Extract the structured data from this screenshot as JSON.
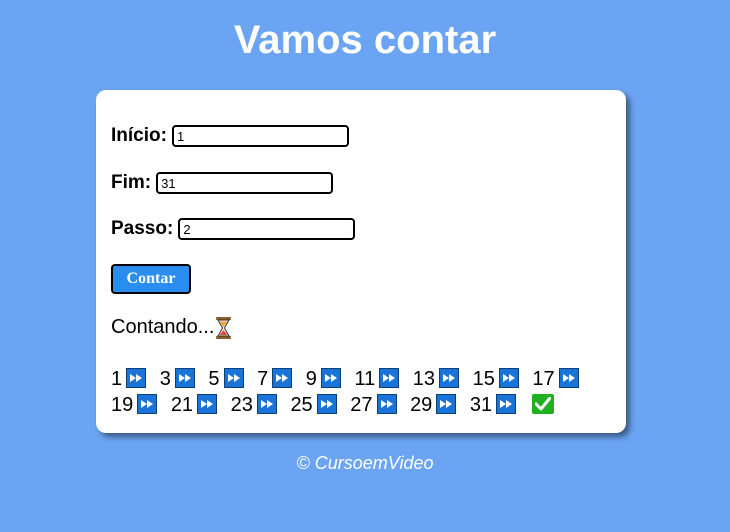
{
  "header": {
    "title": "Vamos contar"
  },
  "form": {
    "inicio": {
      "label": "Início:",
      "value": "1"
    },
    "fim": {
      "label": "Fim:",
      "value": "31"
    },
    "passo": {
      "label": "Passo:",
      "value": "2"
    },
    "button_label": "Contar"
  },
  "status": {
    "text": "Contando...",
    "icon": "hourglass-icon"
  },
  "results": {
    "numbers": [
      "1",
      "3",
      "5",
      "7",
      "9",
      "11",
      "13",
      "15",
      "17",
      "19",
      "21",
      "23",
      "25",
      "27",
      "29",
      "31"
    ],
    "step_icon": "fast-forward-icon",
    "done_icon": "check-mark-icon"
  },
  "footer": {
    "text": "© CursoemVideo"
  },
  "colors": {
    "background": "#6aa4f2",
    "card": "#ffffff",
    "button": "#2a8ef0",
    "step_icon": "#1a73d6",
    "done_icon": "#21b021"
  }
}
